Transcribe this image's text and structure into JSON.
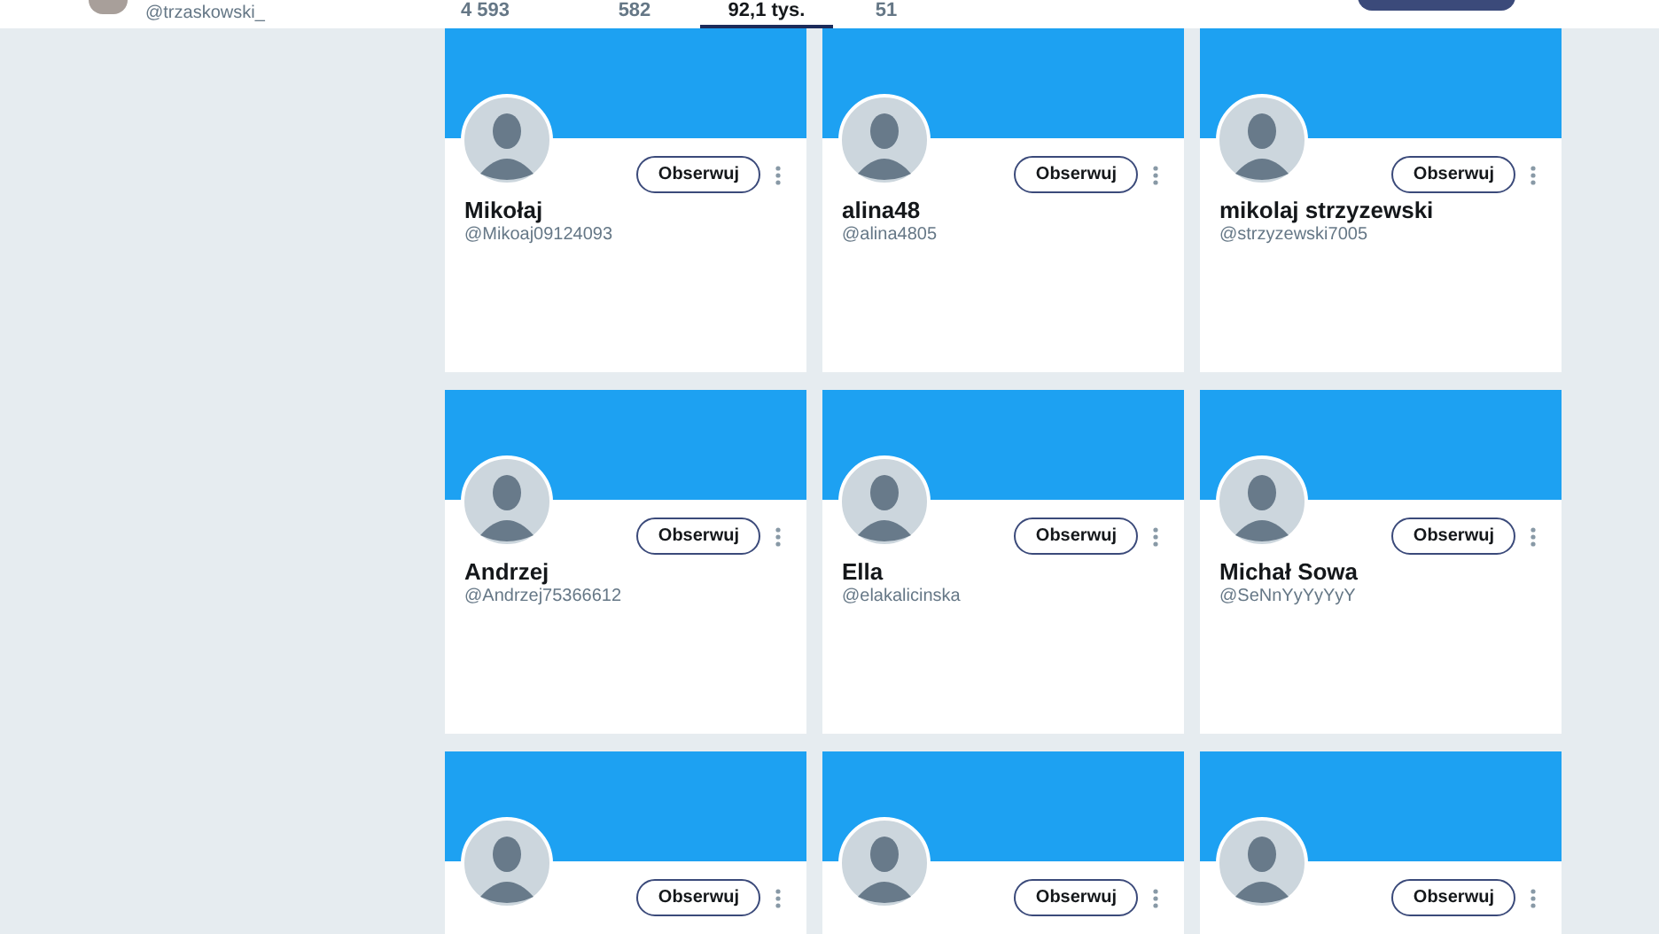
{
  "header": {
    "handle": "@trzaskowski_",
    "stats": [
      {
        "value": "4 593",
        "selected": false
      },
      {
        "value": "582",
        "selected": false
      },
      {
        "value": "92,1 tys.",
        "selected": true
      },
      {
        "value": "51",
        "selected": false
      }
    ]
  },
  "cards": [
    {
      "name": "Mikołaj",
      "handle": "@Mikoaj09124093",
      "button": "Obserwuj"
    },
    {
      "name": "alina48",
      "handle": "@alina4805",
      "button": "Obserwuj"
    },
    {
      "name": "mikolaj strzyzewski",
      "handle": "@strzyzewski7005",
      "button": "Obserwuj"
    },
    {
      "name": "Andrzej",
      "handle": "@Andrzej75366612",
      "button": "Obserwuj"
    },
    {
      "name": "Ella",
      "handle": "@elakalicinska",
      "button": "Obserwuj"
    },
    {
      "name": "Michał Sowa",
      "handle": "@SeNnYyYyYyY",
      "button": "Obserwuj"
    },
    {
      "button": "Obserwuj"
    },
    {
      "button": "Obserwuj"
    },
    {
      "button": "Obserwuj"
    }
  ]
}
